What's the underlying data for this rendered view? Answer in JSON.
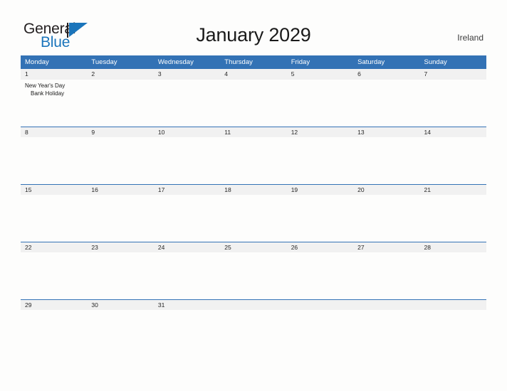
{
  "brand": {
    "name_part1": "General",
    "name_part2": "Blue",
    "triangle_color": "#1b75bb"
  },
  "header": {
    "title": "January 2029",
    "country": "Ireland"
  },
  "theme": {
    "header_blue": "#3372b5",
    "band_gray": "#f1f1f1",
    "page_background": "#fdfdfc",
    "brand_blue": "#1b75bb",
    "text_dark": "#1a1a1a"
  },
  "calendar": {
    "weekdays": [
      "Monday",
      "Tuesday",
      "Wednesday",
      "Thursday",
      "Friday",
      "Saturday",
      "Sunday"
    ],
    "weeks": [
      {
        "days": [
          {
            "number": "1",
            "events": [
              "New Year's Day",
              "Bank Holiday"
            ]
          },
          {
            "number": "2",
            "events": []
          },
          {
            "number": "3",
            "events": []
          },
          {
            "number": "4",
            "events": []
          },
          {
            "number": "5",
            "events": []
          },
          {
            "number": "6",
            "events": []
          },
          {
            "number": "7",
            "events": []
          }
        ]
      },
      {
        "days": [
          {
            "number": "8",
            "events": []
          },
          {
            "number": "9",
            "events": []
          },
          {
            "number": "10",
            "events": []
          },
          {
            "number": "11",
            "events": []
          },
          {
            "number": "12",
            "events": []
          },
          {
            "number": "13",
            "events": []
          },
          {
            "number": "14",
            "events": []
          }
        ]
      },
      {
        "days": [
          {
            "number": "15",
            "events": []
          },
          {
            "number": "16",
            "events": []
          },
          {
            "number": "17",
            "events": []
          },
          {
            "number": "18",
            "events": []
          },
          {
            "number": "19",
            "events": []
          },
          {
            "number": "20",
            "events": []
          },
          {
            "number": "21",
            "events": []
          }
        ]
      },
      {
        "days": [
          {
            "number": "22",
            "events": []
          },
          {
            "number": "23",
            "events": []
          },
          {
            "number": "24",
            "events": []
          },
          {
            "number": "25",
            "events": []
          },
          {
            "number": "26",
            "events": []
          },
          {
            "number": "27",
            "events": []
          },
          {
            "number": "28",
            "events": []
          }
        ]
      },
      {
        "days": [
          {
            "number": "29",
            "events": []
          },
          {
            "number": "30",
            "events": []
          },
          {
            "number": "31",
            "events": []
          },
          {
            "number": "",
            "events": []
          },
          {
            "number": "",
            "events": []
          },
          {
            "number": "",
            "events": []
          },
          {
            "number": "",
            "events": []
          }
        ]
      }
    ]
  }
}
